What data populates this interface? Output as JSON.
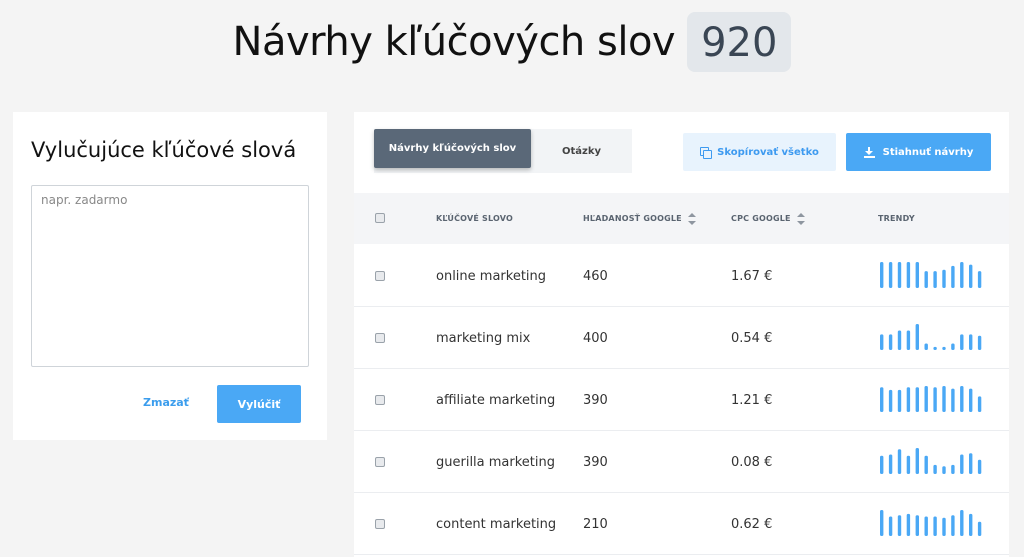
{
  "header": {
    "title": "Návrhy kľúčových slov",
    "count": "920"
  },
  "exclude": {
    "title": "Vylučujúce kľúčové slová",
    "placeholder": "napr. zadarmo",
    "clear_label": "Zmazať",
    "exclude_label": "Vylúčiť"
  },
  "tabs": [
    {
      "label": "Návrhy kľúčových slov",
      "active": true
    },
    {
      "label": "Otázky",
      "active": false
    }
  ],
  "actions": {
    "copy_label": "Skopírovať všetko",
    "download_label": "Stiahnuť návrhy",
    "copy_icon": "copy-icon",
    "download_icon": "download-icon"
  },
  "table": {
    "columns": {
      "keyword": "KĽÚČOVÉ SLOVO",
      "volume": "HĽADANOSŤ GOOGLE",
      "cpc": "CPC GOOGLE",
      "trends": "TRENDY"
    },
    "rows": [
      {
        "keyword": "online marketing",
        "volume": "460",
        "cpc": "1.67 €",
        "trend": [
          1,
          1,
          1,
          1,
          1,
          0.65,
          0.65,
          0.7,
          0.85,
          1,
          0.9,
          0.65
        ]
      },
      {
        "keyword": "marketing mix",
        "volume": "400",
        "cpc": "0.54 €",
        "trend": [
          0.6,
          0.6,
          0.75,
          0.75,
          1,
          0.25,
          0.12,
          0.12,
          0.25,
          0.6,
          0.6,
          0.55
        ]
      },
      {
        "keyword": "affiliate marketing",
        "volume": "390",
        "cpc": "1.21 €",
        "trend": [
          0.95,
          0.85,
          0.85,
          0.95,
          0.95,
          1,
          0.95,
          1,
          0.9,
          1,
          0.9,
          0.6
        ]
      },
      {
        "keyword": "guerilla marketing",
        "volume": "390",
        "cpc": "0.08 €",
        "trend": [
          0.7,
          0.75,
          0.95,
          0.7,
          1,
          0.7,
          0.35,
          0.3,
          0.35,
          0.75,
          0.8,
          0.55
        ]
      },
      {
        "keyword": "content marketing",
        "volume": "210",
        "cpc": "0.62 €",
        "trend": [
          1,
          0.75,
          0.8,
          0.85,
          0.8,
          0.75,
          0.75,
          0.7,
          0.8,
          1,
          0.85,
          0.55
        ]
      }
    ]
  },
  "colors": {
    "accent": "#4aa8f5",
    "tab_active": "#5a6878",
    "trend_bar": "#4aa8f5"
  }
}
